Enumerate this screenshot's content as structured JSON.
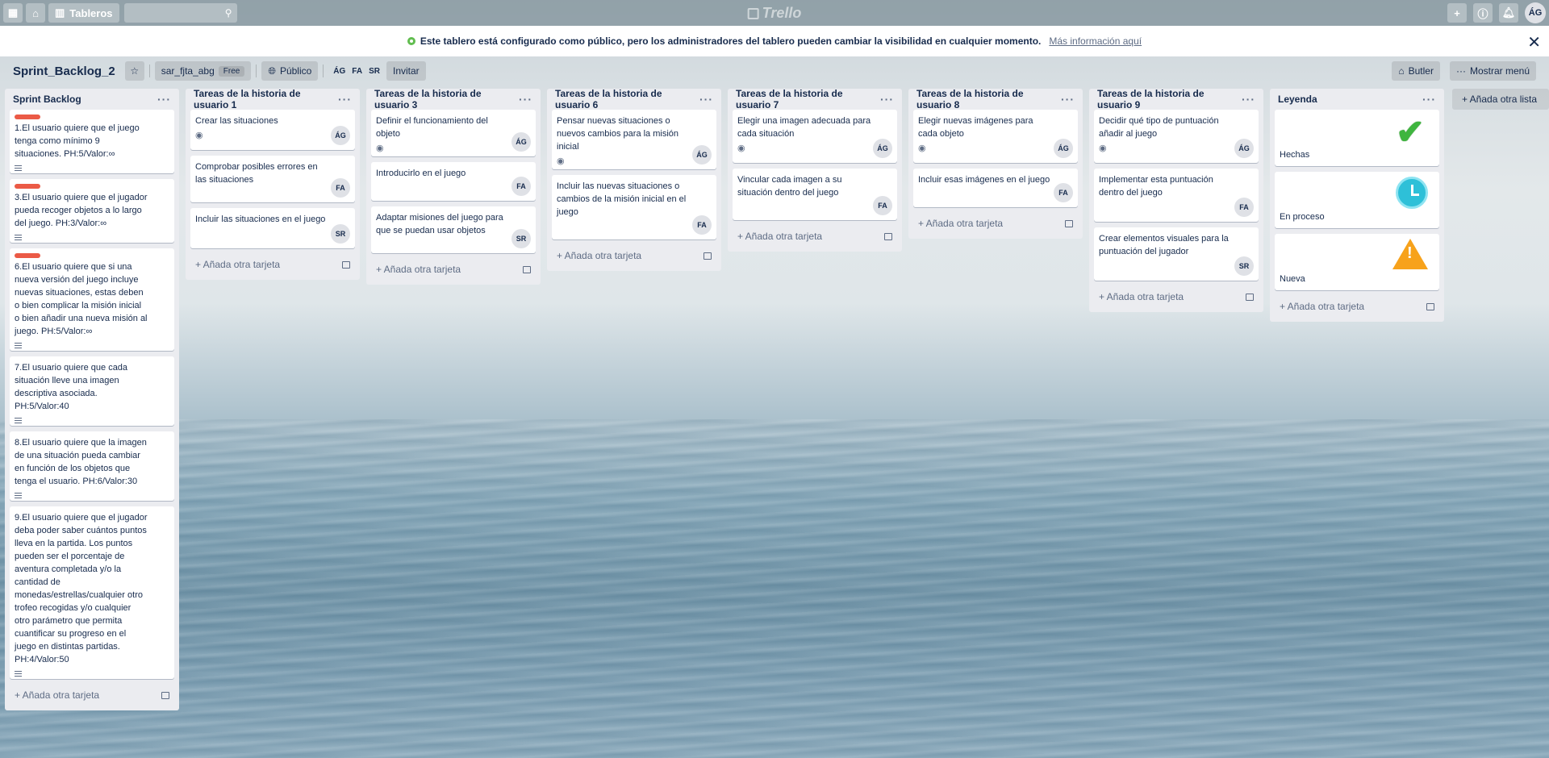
{
  "nav": {
    "boards_label": "Tableros",
    "logo_text": "Trello",
    "user_initials": "ÁG"
  },
  "banner": {
    "text": "Este tablero está configurado como público, pero los administradores del tablero pueden cambiar la visibilidad en cualquier momento.",
    "link": "Más información aquí"
  },
  "board": {
    "title": "Sprint_Backlog_2",
    "team": "sar_fjta_abg",
    "plan": "Free",
    "visibility": "Público",
    "members": [
      "ÁG",
      "FA",
      "SR"
    ],
    "invite": "Invitar",
    "butler": "Butler",
    "show_menu": "Mostrar menú",
    "add_list": "+ Añada otra lista"
  },
  "common": {
    "add_card": "+ Añada otra tarjeta"
  },
  "lists": [
    {
      "title": "Sprint Backlog",
      "cards": [
        {
          "text": "1.El usuario quiere que el juego tenga como mínimo 9 situaciones. PH:5/Valor:∞"
        },
        {
          "text": "3.El usuario quiere que el jugador pueda recoger objetos a lo largo del juego. PH:3/Valor:∞"
        },
        {
          "text": "6.El usuario quiere que si una nueva versión del juego incluye nuevas situaciones, estas deben o bien complicar la misión inicial o bien añadir una nueva misión al juego. PH:5/Valor:∞"
        },
        {
          "text": "7.El usuario quiere que cada situación lleve una imagen descriptiva asociada. PH:5/Valor:40"
        },
        {
          "text": "8.El usuario quiere que la imagen de una situación pueda cambiar en función de los objetos que tenga el usuario. PH:6/Valor:30"
        },
        {
          "text": "9.El usuario quiere que el jugador deba poder saber cuántos puntos lleva en la partida. Los puntos pueden ser el porcentaje de aventura completada y/o la cantidad de monedas/estrellas/cualquier otro trofeo recogidas y/o cualquier otro parámetro que permita cuantificar su progreso en el juego en distintas partidas. PH:4/Valor:50"
        }
      ]
    },
    {
      "title": "Tareas de la historia de usuario 1",
      "cards": [
        {
          "text": "Crear las situaciones",
          "member": "ÁG"
        },
        {
          "text": "Comprobar posibles errores en las situaciones",
          "member": "FA"
        },
        {
          "text": "Incluir las situaciones en el juego",
          "member": "SR"
        }
      ]
    },
    {
      "title": "Tareas de la historia de usuario 3",
      "cards": [
        {
          "text": "Definir el funcionamiento del objeto",
          "member": "ÁG"
        },
        {
          "text": "Introducirlo en el juego",
          "member": "FA"
        },
        {
          "text": "Adaptar misiones del juego para que se puedan usar objetos",
          "member": "SR"
        }
      ]
    },
    {
      "title": "Tareas de la historia de usuario 6",
      "cards": [
        {
          "text": "Pensar nuevas situaciones o nuevos cambios para la misión inicial",
          "member": "ÁG"
        },
        {
          "text": "Incluir las nuevas situaciones o cambios de la misión inicial en el juego",
          "member": "FA"
        }
      ]
    },
    {
      "title": "Tareas de la historia de usuario 7",
      "cards": [
        {
          "text": "Elegir una imagen adecuada para cada situación",
          "member": "ÁG"
        },
        {
          "text": "Vincular cada imagen a su situación dentro del juego",
          "member": "FA"
        }
      ]
    },
    {
      "title": "Tareas de la historia de usuario 8",
      "cards": [
        {
          "text": "Elegir nuevas imágenes para cada objeto",
          "member": "ÁG"
        },
        {
          "text": "Incluir esas imágenes en el juego",
          "member": "FA"
        }
      ]
    },
    {
      "title": "Tareas de la historia de usuario 9",
      "cards": [
        {
          "text": "Decidir qué tipo de puntuación añadir al juego",
          "member": "ÁG"
        },
        {
          "text": "Implementar esta puntuación dentro del juego",
          "member": "FA"
        },
        {
          "text": "Crear elementos visuales para la puntuación del jugador",
          "member": "SR"
        }
      ]
    },
    {
      "title": "Leyenda",
      "cards": [
        {
          "text": "Hechas",
          "icon": "checkmark-icon"
        },
        {
          "text": "En proceso",
          "icon": "clock-icon"
        },
        {
          "text": "Nueva",
          "icon": "warning-icon"
        }
      ]
    }
  ]
}
